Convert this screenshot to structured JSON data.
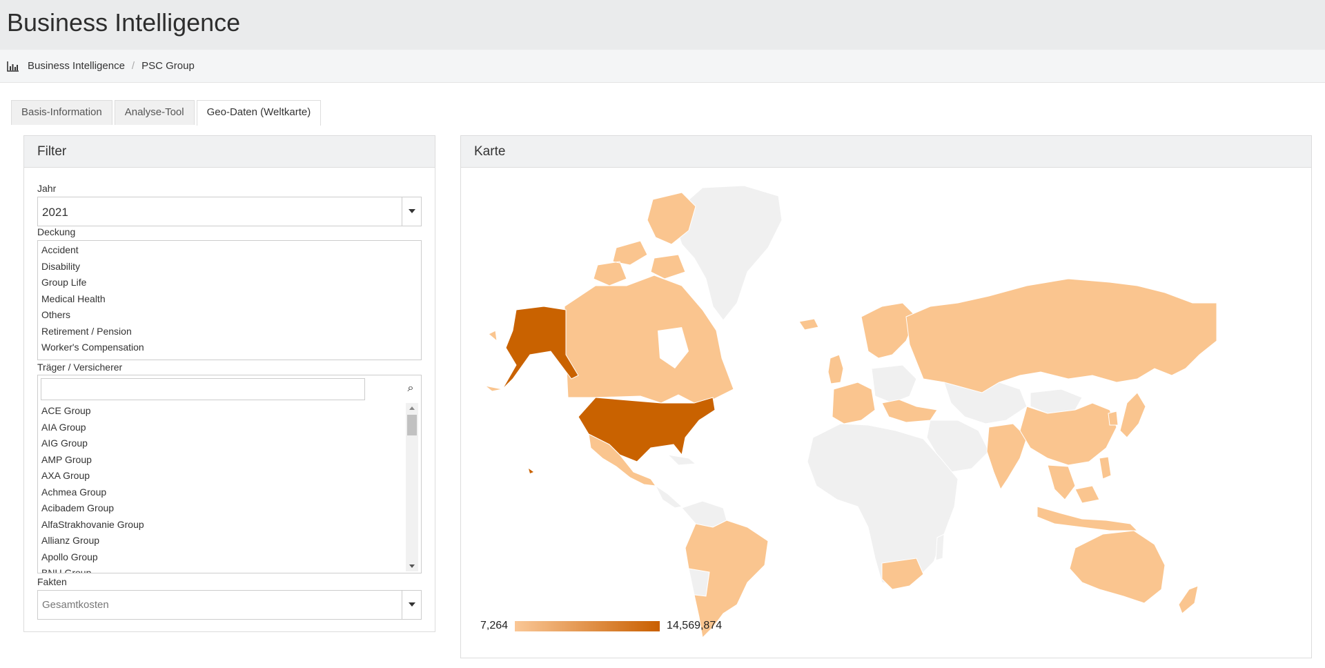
{
  "app": {
    "title": "Business Intelligence"
  },
  "breadcrumb": {
    "icon": "bar-chart-icon",
    "items": [
      "Business Intelligence",
      "PSC Group"
    ],
    "separator": "/"
  },
  "tabs": [
    {
      "label": "Basis-Information",
      "active": false
    },
    {
      "label": "Analyse-Tool",
      "active": false
    },
    {
      "label": "Geo-Daten (Weltkarte)",
      "active": true
    }
  ],
  "filter": {
    "title": "Filter",
    "year": {
      "label": "Jahr",
      "value": "2021"
    },
    "coverage": {
      "label": "Deckung",
      "options": [
        "Accident",
        "Disability",
        "Group Life",
        "Medical Health",
        "Others",
        "Retirement / Pension",
        "Worker's Compensation"
      ]
    },
    "carrier": {
      "label": "Träger / Versicherer",
      "search_value": "",
      "options": [
        "ACE Group",
        "AIA Group",
        "AIG Group",
        "AMP Group",
        "AXA Group",
        "Achmea Group",
        "Acibadem Group",
        "AlfaStrakhovanie Group",
        "Allianz Group",
        "Apollo Group",
        "BNU Group"
      ]
    },
    "facts": {
      "label": "Fakten",
      "value": "Gesamtkosten"
    }
  },
  "map": {
    "title": "Karte",
    "legend": {
      "min": "7,264",
      "max": "14,569,874",
      "color_min": "#fac796",
      "color_max": "#c95f00"
    },
    "colors": {
      "no_data": "#f0f0f0",
      "low": "#fac58f",
      "high": "#c96200",
      "border": "#ffffff"
    }
  }
}
